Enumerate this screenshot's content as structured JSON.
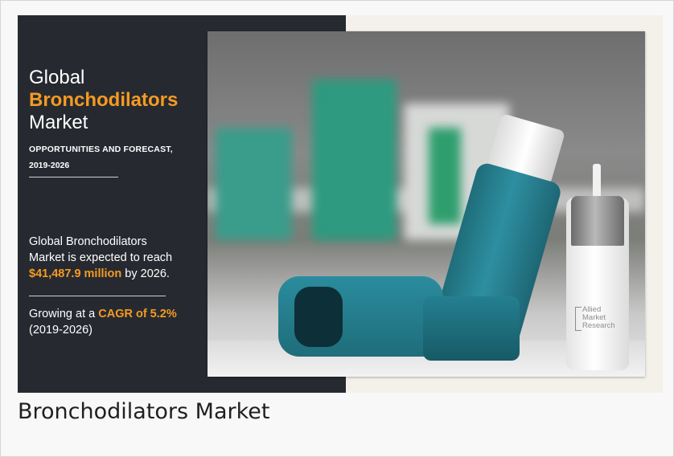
{
  "figure": {
    "heading_line1": "Global",
    "heading_line2": "Bronchodilators",
    "heading_line3": "Market",
    "subheading_line1": "OPPORTUNITIES AND FORECAST,",
    "subheading_line2": "2019-2026",
    "reach_line1": "Global Bronchodilators",
    "reach_line2": "Market is expected to reach",
    "reach_value": "$41,487.9 million",
    "reach_suffix": " by 2026.",
    "cagr_prefix": "Growing at a ",
    "cagr_value": "CAGR of 5.2%",
    "cagr_period": "(2019-2026)",
    "watermark_lines": [
      "Allied",
      "Market",
      "Research"
    ],
    "accent_color": "#f59a23",
    "panel_color": "#262a30"
  },
  "caption": "Bronchodilators Market"
}
